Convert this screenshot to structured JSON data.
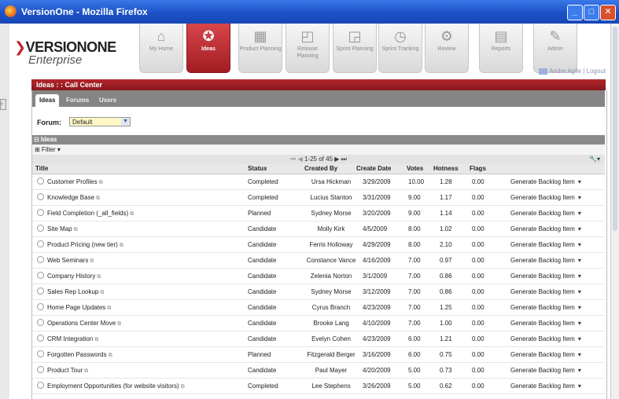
{
  "window": {
    "title": "VersionOne - Mozilla Firefox",
    "min": "_",
    "max": "□",
    "close": "✕"
  },
  "logo": {
    "brand": "VERSIONONE",
    "sub": "Enterprise"
  },
  "nav": [
    {
      "label": "My Home",
      "icon": "⌂"
    },
    {
      "label": "Ideas",
      "icon": "✪"
    },
    {
      "label": "Product Planning",
      "icon": "▦"
    },
    {
      "label": "Release Planning",
      "icon": "◰"
    },
    {
      "label": "Sprint Planning",
      "icon": "◲"
    },
    {
      "label": "Sprint Tracking",
      "icon": "◷"
    },
    {
      "label": "Review",
      "icon": "⚙"
    },
    {
      "label": "Reports",
      "icon": "▤"
    },
    {
      "label": "Admin",
      "icon": "✎"
    }
  ],
  "user": {
    "name": "Andre Agile",
    "separator": "|",
    "logout": "Logout"
  },
  "panel": {
    "title": "Ideas : : Call Center"
  },
  "tabs": [
    {
      "label": "Ideas"
    },
    {
      "label": "Forums"
    },
    {
      "label": "Users"
    }
  ],
  "forum": {
    "label": "Forum:",
    "value": "Default",
    "arrow": "▼"
  },
  "ideas_section": {
    "title": "⊟ Ideas"
  },
  "filter": {
    "label": "⊞ Filter ▾"
  },
  "pager": {
    "first": "⏮",
    "prev": "◀",
    "range": "1-25 of 45",
    "next": "▶",
    "last": "⏭",
    "tool": "🔧▾"
  },
  "columns": {
    "title": "Title",
    "status": "Status",
    "created_by": "Created By",
    "create_date": "Create Date",
    "votes": "Votes",
    "hotness": "Hotness",
    "flags": "Flags"
  },
  "rows": [
    {
      "title": "Customer Profiles",
      "status": "Completed",
      "created_by": "Ursa Hickman",
      "date": "3/29/2009",
      "votes": "10.00",
      "hotness": "1.28",
      "flags": "0.00",
      "action": "Generate Backlog Item"
    },
    {
      "title": "Knowledge Base",
      "status": "Completed",
      "created_by": "Lucius Stanton",
      "date": "3/31/2009",
      "votes": "9.00",
      "hotness": "1.17",
      "flags": "0.00",
      "action": "Generate Backlog Item"
    },
    {
      "title": "Field Completion (_all_fields)",
      "status": "Planned",
      "created_by": "Sydney Morse",
      "date": "3/20/2009",
      "votes": "9.00",
      "hotness": "1.14",
      "flags": "0.00",
      "action": "Generate Backlog Item"
    },
    {
      "title": "Site Map",
      "status": "Candidate",
      "created_by": "Molly Kirk",
      "date": "4/5/2009",
      "votes": "8.00",
      "hotness": "1.02",
      "flags": "0.00",
      "action": "Generate Backlog Item"
    },
    {
      "title": "Product Pricing (new tier)",
      "status": "Candidate",
      "created_by": "Ferris Holloway",
      "date": "4/29/2009",
      "votes": "8.00",
      "hotness": "2.10",
      "flags": "0.00",
      "action": "Generate Backlog Item"
    },
    {
      "title": "Web Seminars",
      "status": "Candidate",
      "created_by": "Constance Vance",
      "date": "4/16/2009",
      "votes": "7.00",
      "hotness": "0.97",
      "flags": "0.00",
      "action": "Generate Backlog Item"
    },
    {
      "title": "Company History",
      "status": "Candidate",
      "created_by": "Zelenia Norton",
      "date": "3/1/2009",
      "votes": "7.00",
      "hotness": "0.86",
      "flags": "0.00",
      "action": "Generate Backlog Item"
    },
    {
      "title": "Sales Rep Lookup",
      "status": "Candidate",
      "created_by": "Sydney Morse",
      "date": "3/12/2009",
      "votes": "7.00",
      "hotness": "0.86",
      "flags": "0.00",
      "action": "Generate Backlog Item"
    },
    {
      "title": "Home Page Updates",
      "status": "Candidate",
      "created_by": "Cyrus Branch",
      "date": "4/23/2009",
      "votes": "7.00",
      "hotness": "1.25",
      "flags": "0.00",
      "action": "Generate Backlog Item"
    },
    {
      "title": "Operations Center Move",
      "status": "Candidate",
      "created_by": "Brooke Lang",
      "date": "4/10/2009",
      "votes": "7.00",
      "hotness": "1.00",
      "flags": "0.00",
      "action": "Generate Backlog Item"
    },
    {
      "title": "CRM Integration",
      "status": "Candidate",
      "created_by": "Evelyn Cohen",
      "date": "4/23/2009",
      "votes": "6.00",
      "hotness": "1.21",
      "flags": "0.00",
      "action": "Generate Backlog Item"
    },
    {
      "title": "Forgotten Passwords",
      "status": "Planned",
      "created_by": "Fitzgerald Berger",
      "date": "3/16/2009",
      "votes": "6.00",
      "hotness": "0.75",
      "flags": "0.00",
      "action": "Generate Backlog Item"
    },
    {
      "title": "Product Tour",
      "status": "Candidate",
      "created_by": "Paul Mayer",
      "date": "4/20/2009",
      "votes": "5.00",
      "hotness": "0.73",
      "flags": "0.00",
      "action": "Generate Backlog Item"
    },
    {
      "title": "Employment Opportunities (for website visitors)",
      "status": "Completed",
      "created_by": "Lee Stephens",
      "date": "3/26/2009",
      "votes": "5.00",
      "hotness": "0.62",
      "flags": "0.00",
      "action": "Generate Backlog Item"
    }
  ],
  "colors": {
    "titlebar": "#1c52c6",
    "accent": "#a11d22",
    "tabbar": "#858585"
  }
}
